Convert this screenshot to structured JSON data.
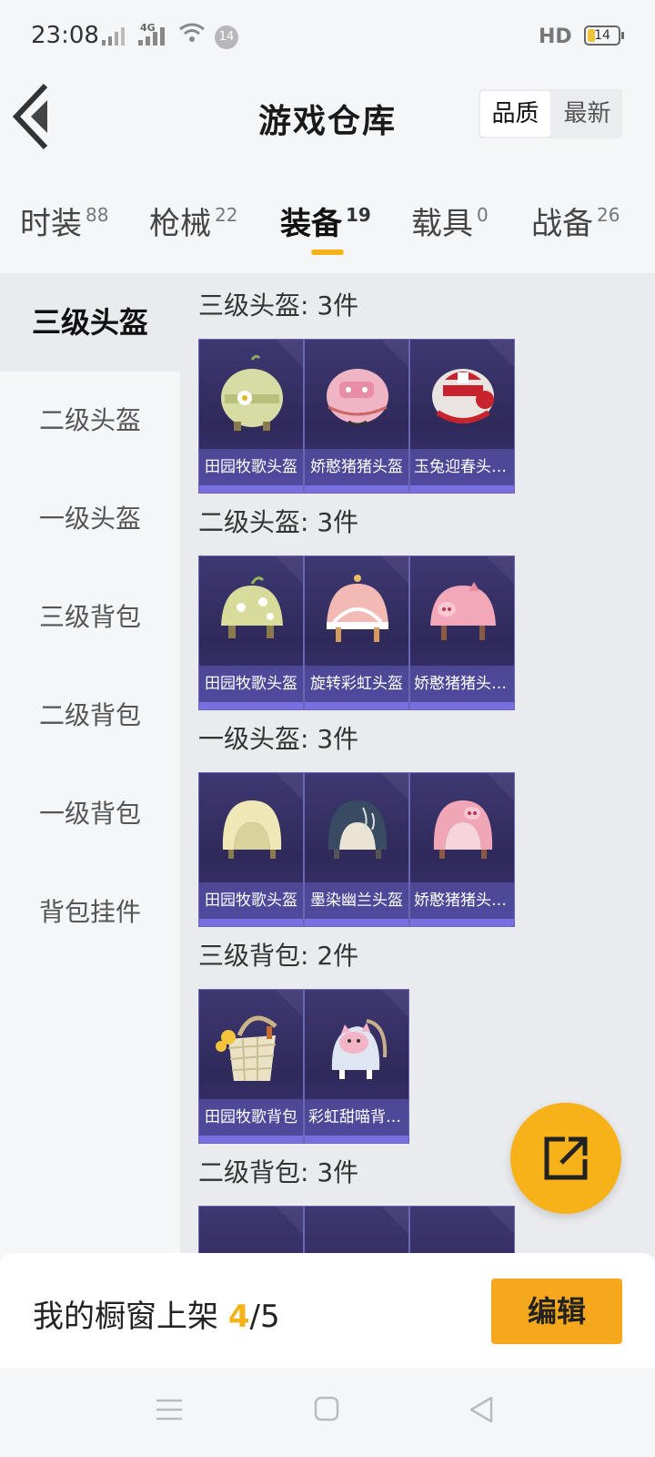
{
  "status": {
    "time": "23:08",
    "network": "4G",
    "notification_count": "14",
    "hd": "HD",
    "battery": "14"
  },
  "header": {
    "title": "游戏仓库",
    "sort": [
      "品质",
      "最新"
    ]
  },
  "tabs": [
    {
      "label": "时装",
      "count": "88"
    },
    {
      "label": "枪械",
      "count": "22"
    },
    {
      "label": "装备",
      "count": "19"
    },
    {
      "label": "载具",
      "count": "0"
    },
    {
      "label": "战备",
      "count": "26"
    }
  ],
  "side_menu": [
    "三级头盔",
    "二级头盔",
    "一级头盔",
    "三级背包",
    "二级背包",
    "一级背包",
    "背包挂件"
  ],
  "sections": [
    {
      "title": "三级头盔: 3件",
      "items": [
        "田园牧歌头盔",
        "娇憨猪猪头盔",
        "玉兔迎春头盔..."
      ]
    },
    {
      "title": "二级头盔: 3件",
      "items": [
        "田园牧歌头盔",
        "旋转彩虹头盔",
        "娇憨猪猪头盔..."
      ]
    },
    {
      "title": "一级头盔: 3件",
      "items": [
        "田园牧歌头盔",
        "墨染幽兰头盔",
        "娇憨猪猪头盔..."
      ]
    },
    {
      "title": "三级背包: 2件",
      "items": [
        "田园牧歌背包",
        "彩虹甜喵背包..."
      ]
    },
    {
      "title": "二级背包: 3件",
      "items": []
    }
  ],
  "bottom": {
    "label": "我的橱窗上架",
    "current": "4",
    "total": "/5",
    "edit": "编辑"
  },
  "colors": {
    "accent": "#f5b31b",
    "card_bg": "#2f2a5a"
  }
}
